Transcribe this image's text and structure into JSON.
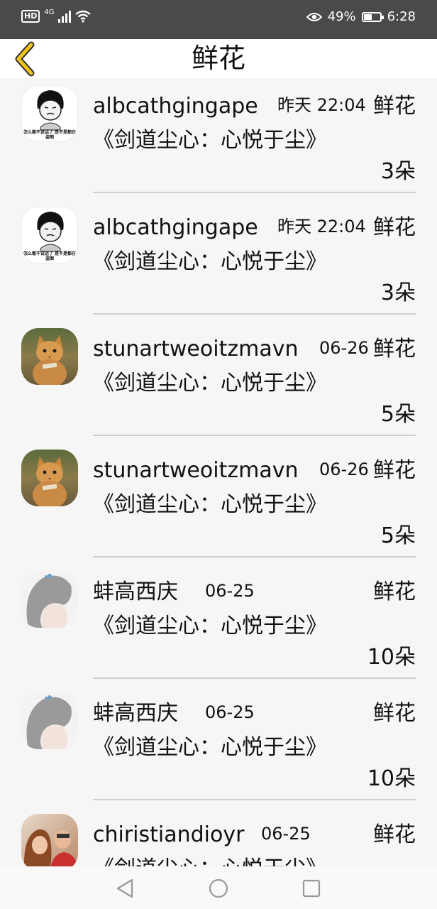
{
  "status_bar": {
    "hd": "HD",
    "network": "4G",
    "battery": "49%",
    "time": "6:28"
  },
  "header": {
    "title": "鲜花"
  },
  "items": [
    {
      "name": "albcathgingape",
      "date": "昨天 22:04",
      "gift": "鲜花",
      "book": "《剑道尘心：心悦于尘》",
      "count": "3朵",
      "avatar_icon": "meme-face-avatar",
      "avatar_text": "怎么都不说话了 是不是都在盗图"
    },
    {
      "name": "albcathgingape",
      "date": "昨天 22:04",
      "gift": "鲜花",
      "book": "《剑道尘心：心悦于尘》",
      "count": "3朵",
      "avatar_icon": "meme-face-avatar",
      "avatar_text": "怎么都不说话了 是不是都在盗图"
    },
    {
      "name": "stunartweoitzmavn",
      "date": "06-26",
      "gift": "鲜花",
      "book": "《剑道尘心：心悦于尘》",
      "count": "5朵",
      "avatar_icon": "cat-photo-avatar"
    },
    {
      "name": "stunartweoitzmavn",
      "date": "06-26",
      "gift": "鲜花",
      "book": "《剑道尘心：心悦于尘》",
      "count": "5朵",
      "avatar_icon": "cat-photo-avatar"
    },
    {
      "name": "蚌高西庆",
      "date": "06-25",
      "gift": "鲜花",
      "book": "《剑道尘心：心悦于尘》",
      "count": "10朵",
      "avatar_icon": "girl-sketch-avatar"
    },
    {
      "name": "蚌高西庆",
      "date": "06-25",
      "gift": "鲜花",
      "book": "《剑道尘心：心悦于尘》",
      "count": "10朵",
      "avatar_icon": "girl-sketch-avatar"
    },
    {
      "name": "chiristiandioyr",
      "date": "06-25",
      "gift": "鲜花",
      "book": "《剑道尘心：心悦于尘》",
      "count": "",
      "avatar_icon": "two-people-photo-avatar"
    }
  ],
  "colors": {
    "status_bar_bg": "#4a4a4a",
    "back_arrow": "#f0c419",
    "list_bg": "#f7f6f7",
    "divider": "#cfcfcf"
  }
}
